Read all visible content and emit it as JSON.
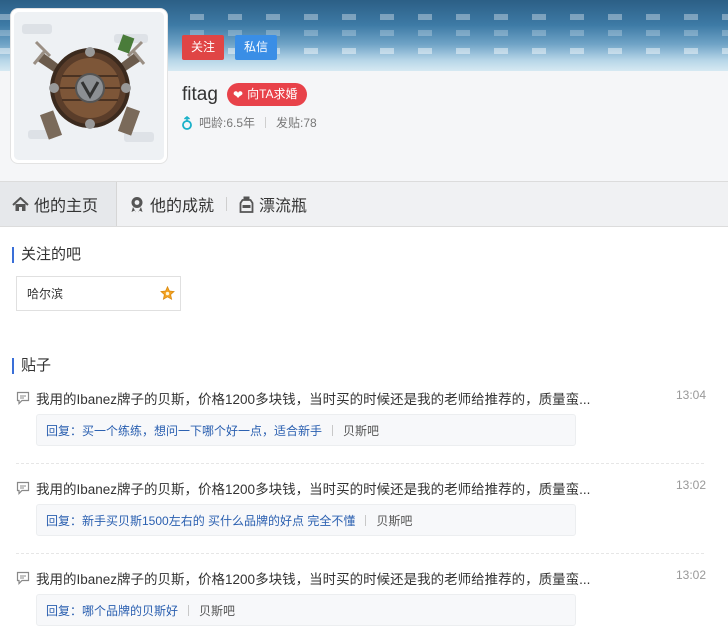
{
  "profile": {
    "username": "fitag",
    "propose_label": "向TA求婚",
    "follow_label": "关注",
    "message_label": "私信",
    "age_text": "吧龄:6.5年",
    "posts_text": "发贴:78"
  },
  "nav": {
    "tabs": [
      {
        "label": "他的主页",
        "icon": "home-icon"
      },
      {
        "label": "他的成就",
        "icon": "medal-icon"
      },
      {
        "label": "漂流瓶",
        "icon": "bottle-icon"
      }
    ]
  },
  "followed_bars": {
    "title": "关注的吧",
    "items": [
      {
        "name": "哈尔滨",
        "badge": "star-badge-icon"
      }
    ]
  },
  "posts": {
    "title": "贴子",
    "items": [
      {
        "text": "我用的Ibanez牌子的贝斯，价格1200多块钱，当时买的时候还是我的老师给推荐的，质量蛮...",
        "time": "13:04",
        "reply": "回复：买一个练练，想问一下哪个好一点，适合新手",
        "bar": "贝斯吧"
      },
      {
        "text": "我用的Ibanez牌子的贝斯，价格1200多块钱，当时买的时候还是我的老师给推荐的，质量蛮...",
        "time": "13:02",
        "reply": "回复：新手买贝斯1500左右的 买什么品牌的好点 完全不懂",
        "bar": "贝斯吧"
      },
      {
        "text": "我用的Ibanez牌子的贝斯，价格1200多块钱，当时买的时候还是我的老师给推荐的，质量蛮...",
        "time": "13:02",
        "reply": "回复：哪个品牌的贝斯好",
        "bar": "贝斯吧"
      }
    ]
  },
  "colors": {
    "follow": "#e04545",
    "message": "#3a8ee6",
    "propose": "#e8424a",
    "accent": "#3a6fd8",
    "reply_link": "#2a5fb0"
  }
}
